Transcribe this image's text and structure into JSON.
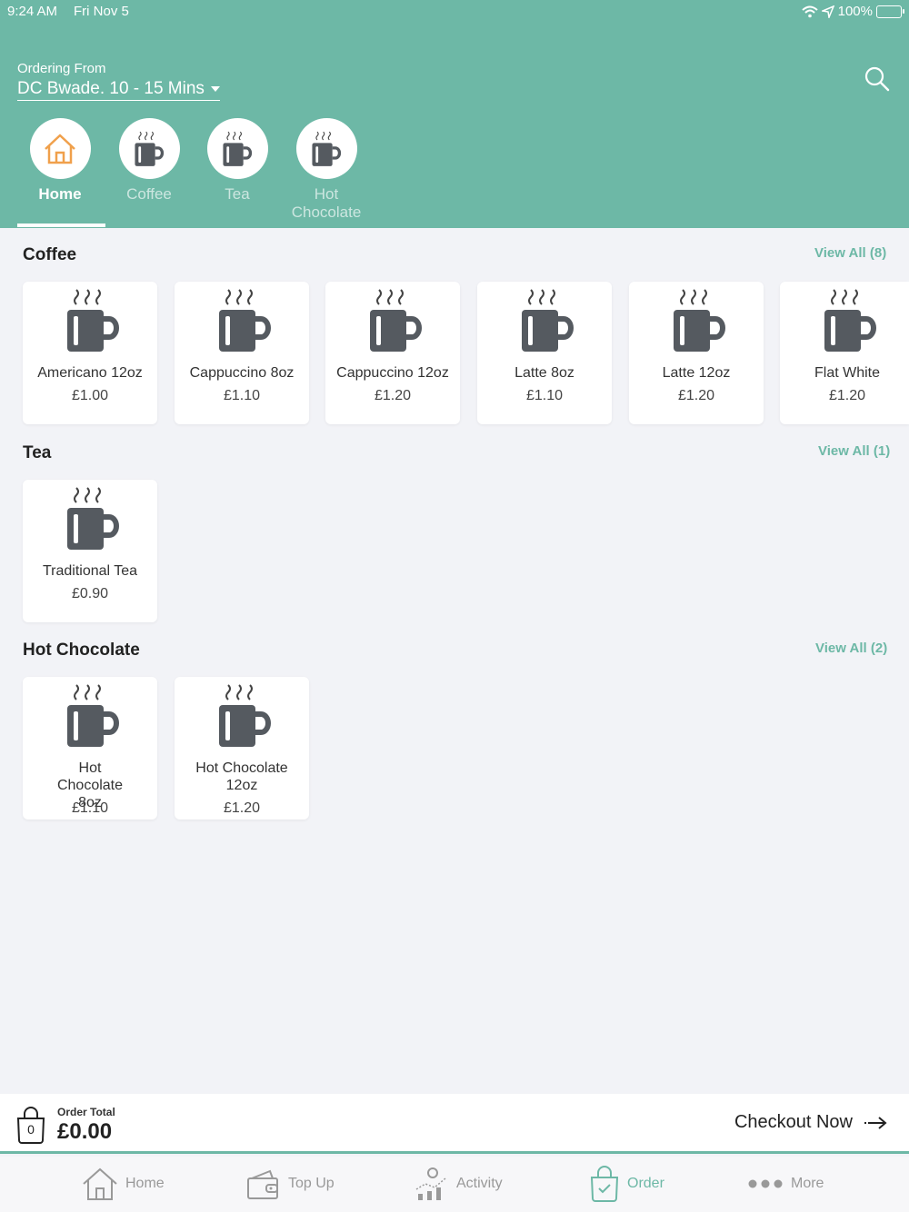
{
  "status_bar": {
    "time": "9:24 AM",
    "date": "Fri Nov 5",
    "battery": "100%"
  },
  "header": {
    "ordering_label": "Ordering From",
    "location": "DC Bwade. 10 - 15 Mins",
    "tabs": [
      {
        "label": "Home",
        "active": true,
        "icon": "house-icon"
      },
      {
        "label": "Coffee",
        "icon": "mug-icon"
      },
      {
        "label": "Tea",
        "icon": "mug-icon"
      },
      {
        "label": "Hot Chocolate",
        "icon": "mug-icon"
      }
    ],
    "accent_color": "#6db8a6"
  },
  "sections": {
    "coffee": {
      "title": "Coffee",
      "view_all": "View All (8)",
      "items": [
        {
          "name": "Americano 12oz",
          "price": "£1.00"
        },
        {
          "name": "Cappuccino 8oz",
          "price": "£1.10"
        },
        {
          "name": "Cappuccino 12oz",
          "price": "£1.20"
        },
        {
          "name": "Latte 8oz",
          "price": "£1.10"
        },
        {
          "name": "Latte 12oz",
          "price": "£1.20"
        },
        {
          "name": "Flat White",
          "price": "£1.20"
        }
      ]
    },
    "tea": {
      "title": "Tea",
      "view_all": "View All (1)",
      "items": [
        {
          "name": "Traditional Tea",
          "price": "£0.90"
        }
      ]
    },
    "hot_chocolate": {
      "title": "Hot Chocolate",
      "view_all": "View All (2)",
      "items": [
        {
          "name": "Hot Chocolate 8oz",
          "price": "£1.10"
        },
        {
          "name": "Hot Chocolate 12oz",
          "price": "£1.20"
        }
      ]
    }
  },
  "order_bar": {
    "bag_count": "0",
    "label": "Order Total",
    "total": "£0.00",
    "checkout": "Checkout Now"
  },
  "tabbar": [
    {
      "label": "Home",
      "icon": "house-icon"
    },
    {
      "label": "Top Up",
      "icon": "wallet-icon"
    },
    {
      "label": "Activity",
      "icon": "activity-chart-icon"
    },
    {
      "label": "Order",
      "icon": "shopping-bag-icon",
      "active": true
    },
    {
      "label": "More",
      "icon": "more-dots-icon"
    }
  ]
}
